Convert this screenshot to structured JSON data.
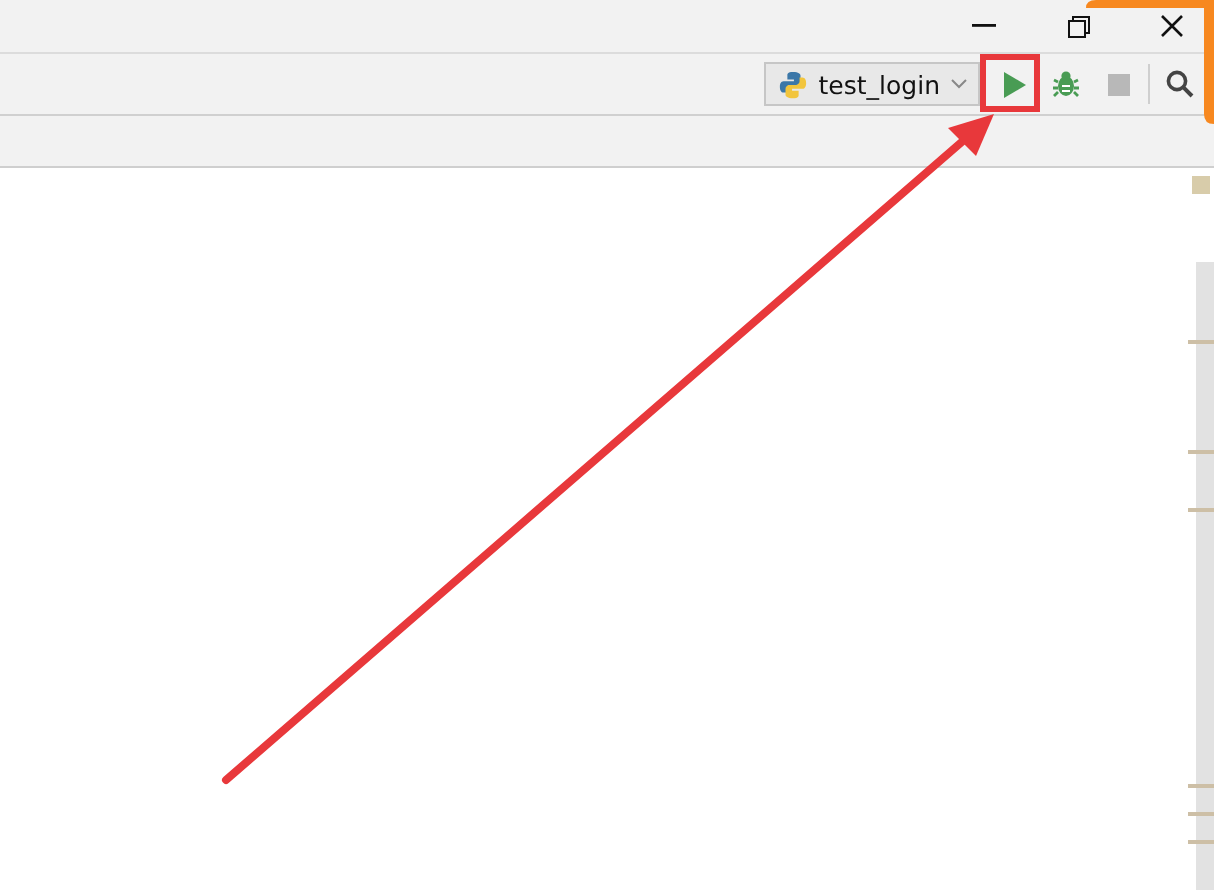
{
  "toolbar": {
    "run_configuration": {
      "label": "test_login"
    }
  }
}
